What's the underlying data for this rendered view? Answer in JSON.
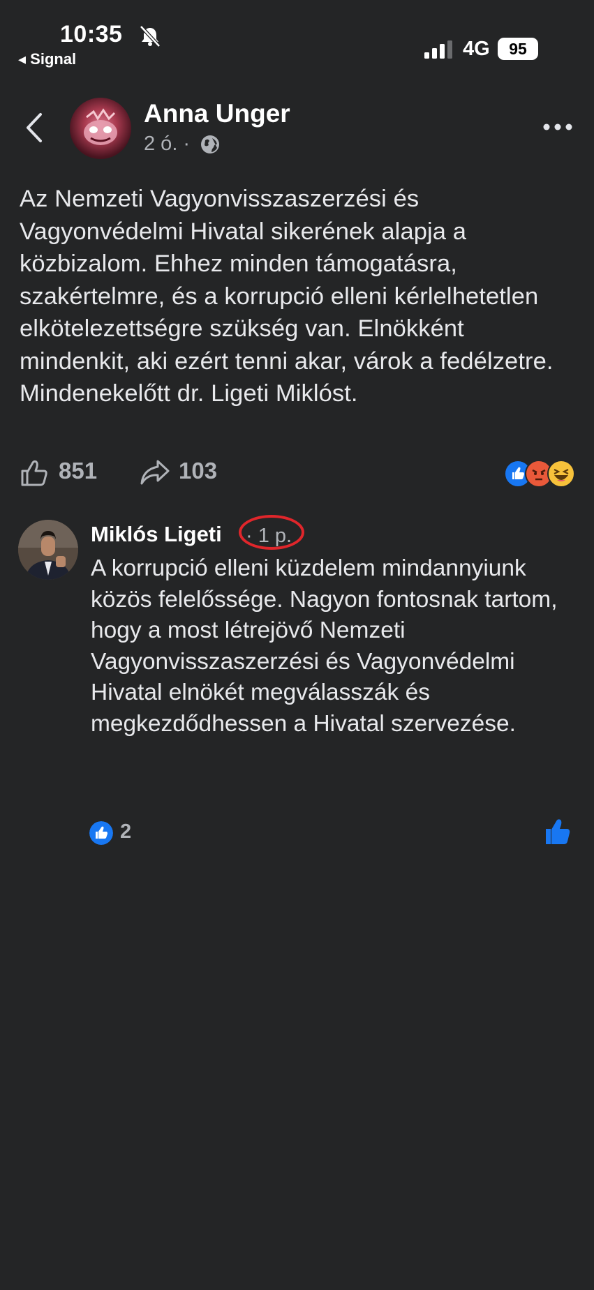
{
  "status_bar": {
    "time": "10:35",
    "back_app": "◂ Signal",
    "network": "4G",
    "battery": "95",
    "icons": [
      "bell-muted-icon",
      "signal-bars-icon",
      "battery-icon"
    ]
  },
  "post": {
    "author": "Anna Unger",
    "time": "2 ó. ·",
    "text": "Az Nemzeti Vagyonvisszaszerzési és Vagyonvédelmi Hivatal sikerének alapja a közbizalom. Ehhez minden támogatásra, szakértelmre, és a korrupció elleni kérlelhetetlen elkötelezettségre szükség van. Elnökként mindenkit, aki ezért tenni akar, várok a fedélzetre. Mindenekelőtt dr. Ligeti Miklóst.",
    "likes": "851",
    "shares": "103",
    "reactions": [
      "like",
      "angry",
      "haha"
    ]
  },
  "comment": {
    "author": "Miklós Ligeti",
    "time": "· 1 p.",
    "text": "A korrupció elleni küzdelem mindannyiunk közös felelőssége. Nagyon fontosnak tartom, hogy a most létrejövő Nemzeti Vagyonvisszaszerzési és Vagyonvédelmi Hivatal elnökét megválasszák és megkezdődhessen a Hivatal szervezése.",
    "likes": "2"
  },
  "colors": {
    "background": "#242526",
    "text": "#e4e6eb",
    "secondary": "#b0b3b8",
    "like_blue": "#1877f2",
    "highlight_ring": "#e0262b"
  }
}
